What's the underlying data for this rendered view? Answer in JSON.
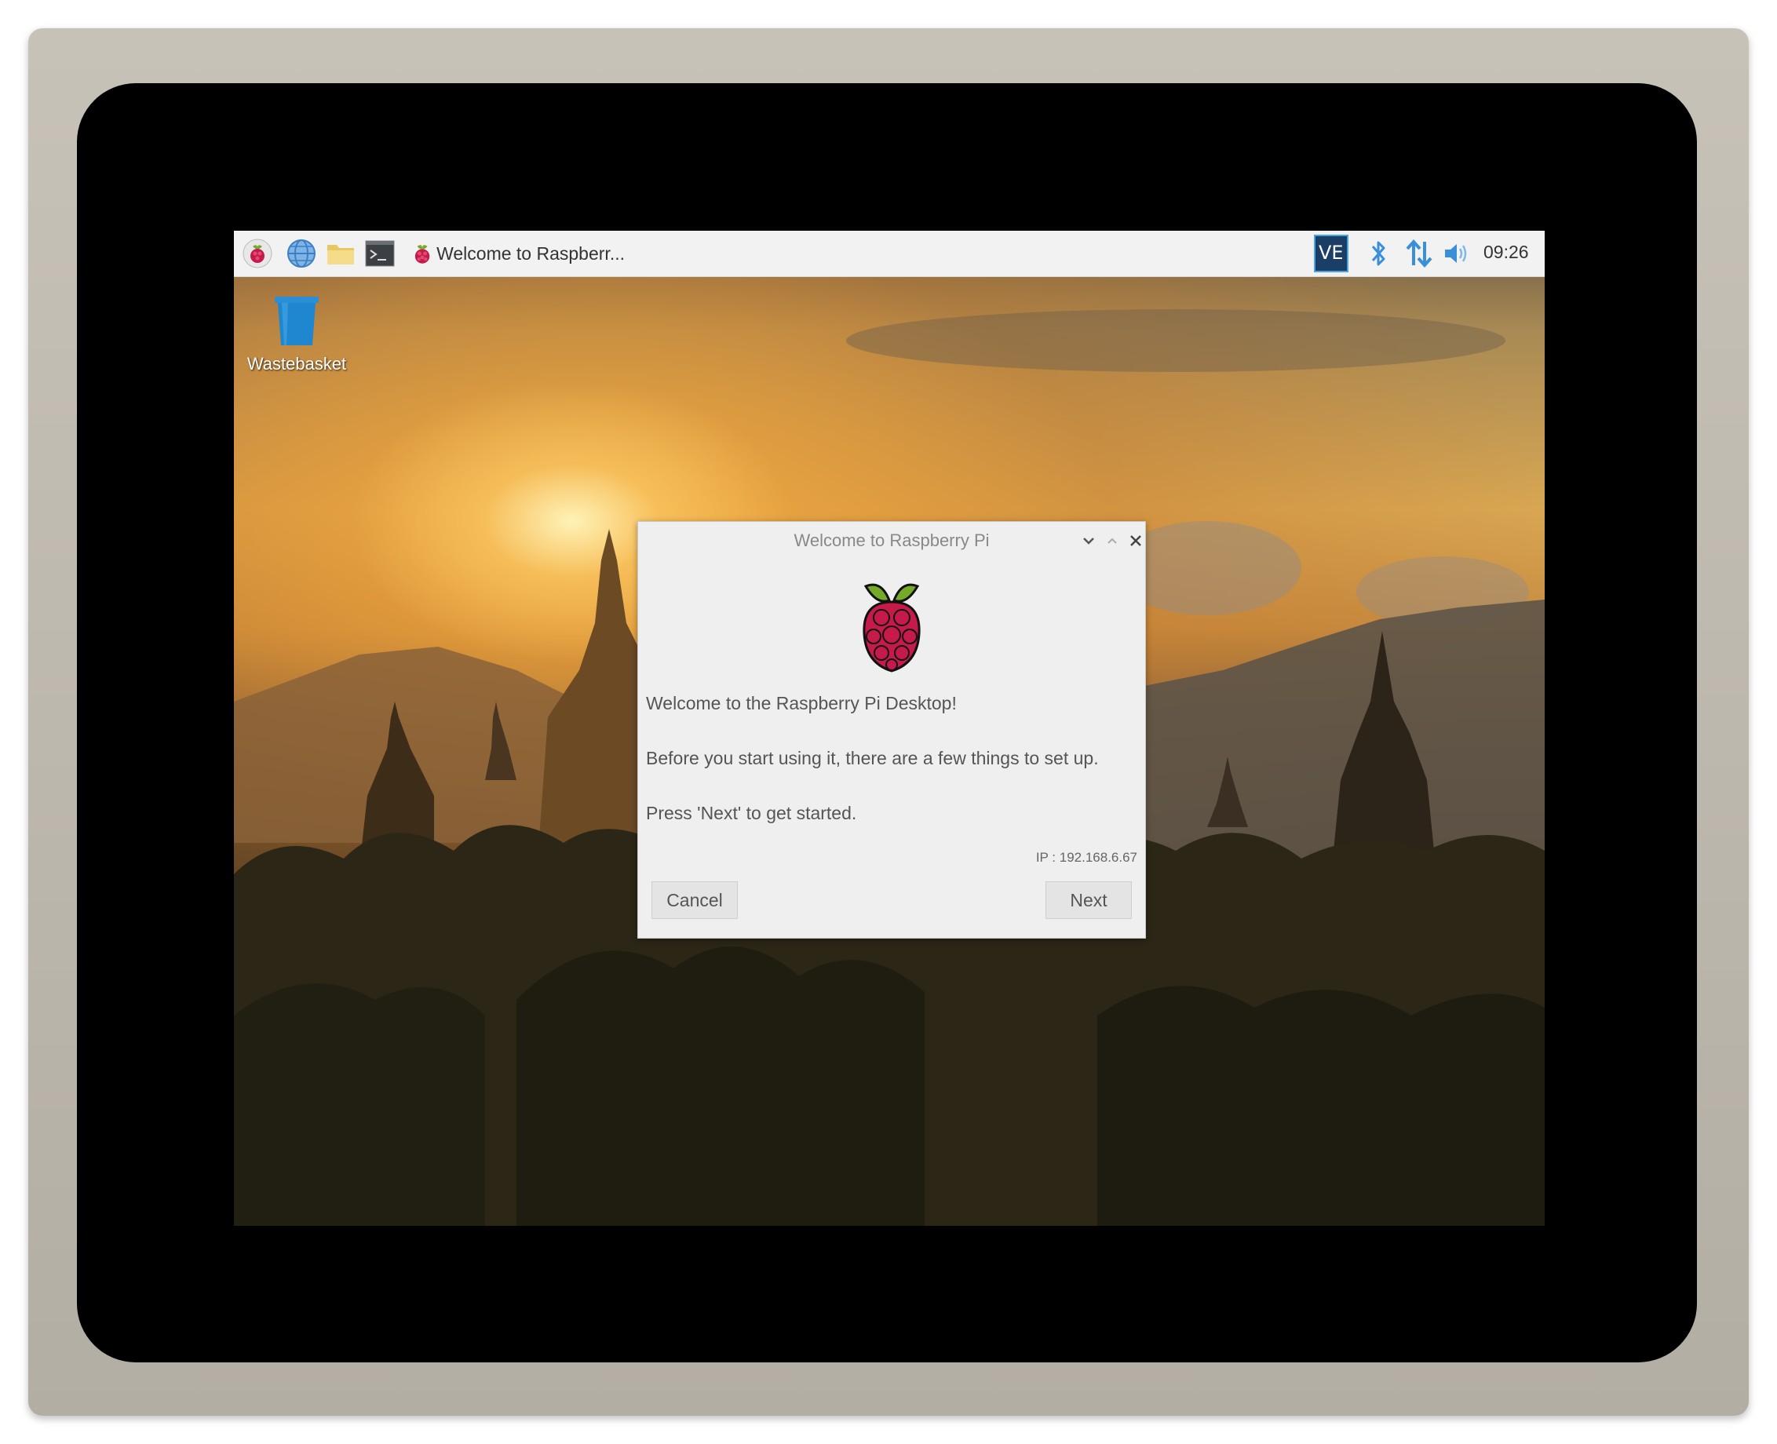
{
  "taskbar": {
    "launchers": [
      {
        "icon": "raspberry-menu-icon"
      },
      {
        "icon": "web-browser-icon"
      },
      {
        "icon": "file-manager-icon"
      },
      {
        "icon": "terminal-icon"
      }
    ],
    "task": {
      "icon": "raspberry-icon",
      "label": "Welcome to Raspberr..."
    },
    "tray": {
      "vnc_label": "VE",
      "icons": [
        "vnc-icon",
        "bluetooth-icon",
        "network-arrows-icon",
        "volume-icon"
      ]
    },
    "clock": "09:26"
  },
  "desktop": {
    "icons": [
      {
        "label": "Wastebasket",
        "icon": "wastebasket-icon"
      }
    ]
  },
  "dialog": {
    "title": "Welcome to Raspberry Pi",
    "line1": "Welcome to the Raspberry Pi Desktop!",
    "line2": "Before you start using it, there are a few things to set up.",
    "line3": "Press 'Next' to get started.",
    "ip": "IP : 192.168.6.67",
    "cancel_label": "Cancel",
    "next_label": "Next"
  },
  "colors": {
    "raspberry_red": "#c51a4a",
    "leaf_green": "#75a928",
    "tray_blue": "#4da4e0",
    "taskbar_bg": "#f2f2f2",
    "dialog_bg": "#efefef"
  }
}
